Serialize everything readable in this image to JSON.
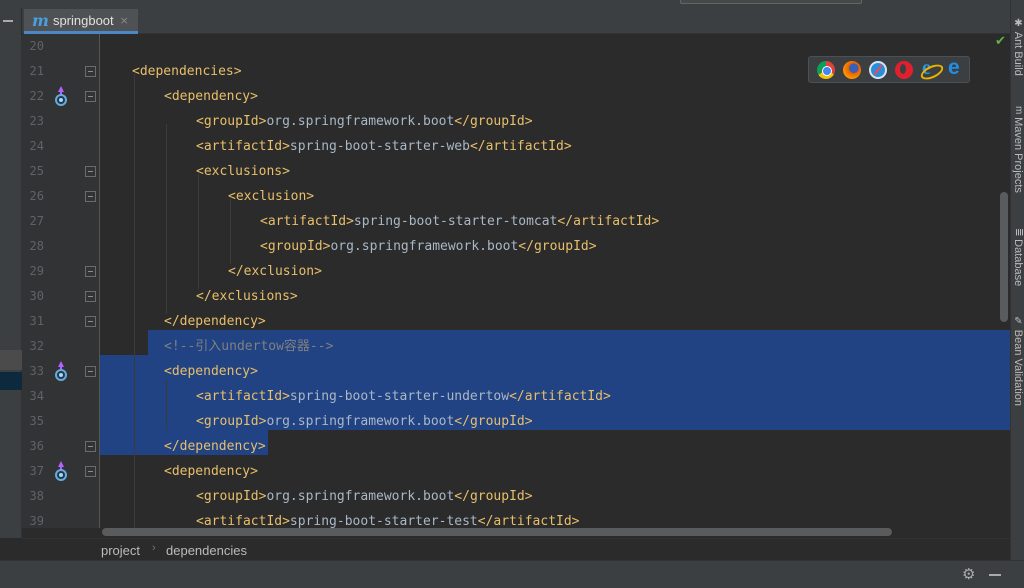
{
  "tab": {
    "icon": "maven-m-icon",
    "name": "springboot",
    "close": "×"
  },
  "lines": [
    {
      "no": "20",
      "html": []
    },
    {
      "no": "21",
      "html": [
        [
          "tg",
          "<dependencies>"
        ]
      ]
    },
    {
      "no": "22",
      "html": [
        [
          "tg",
          "<dependency>"
        ]
      ]
    },
    {
      "no": "23",
      "html": [
        [
          "tg",
          "<groupId>"
        ],
        [
          "tx",
          "org.springframework.boot"
        ],
        [
          "tg",
          "</groupId>"
        ]
      ]
    },
    {
      "no": "24",
      "html": [
        [
          "tg",
          "<artifactId>"
        ],
        [
          "tx",
          "spring-boot-starter-web"
        ],
        [
          "tg",
          "</artifactId>"
        ]
      ]
    },
    {
      "no": "25",
      "html": [
        [
          "tg",
          "<exclusions>"
        ]
      ]
    },
    {
      "no": "26",
      "html": [
        [
          "tg",
          "<exclusion>"
        ]
      ]
    },
    {
      "no": "27",
      "html": [
        [
          "tg",
          "<artifactId>"
        ],
        [
          "tx",
          "spring-boot-starter-tomcat"
        ],
        [
          "tg",
          "</artifactId>"
        ]
      ]
    },
    {
      "no": "28",
      "html": [
        [
          "tg",
          "<groupId>"
        ],
        [
          "tx",
          "org.springframework.boot"
        ],
        [
          "tg",
          "</groupId>"
        ]
      ]
    },
    {
      "no": "29",
      "html": [
        [
          "tg",
          "</exclusion>"
        ]
      ]
    },
    {
      "no": "30",
      "html": [
        [
          "tg",
          "</exclusions>"
        ]
      ]
    },
    {
      "no": "31",
      "html": [
        [
          "tg",
          "</dependency>"
        ]
      ]
    },
    {
      "no": "32",
      "html": [
        [
          "cm",
          "<!--引入undertow容器-->"
        ]
      ]
    },
    {
      "no": "33",
      "html": [
        [
          "tg",
          "<dependency>"
        ]
      ]
    },
    {
      "no": "34",
      "html": [
        [
          "tg",
          "<artifactId>"
        ],
        [
          "tx",
          "spring-boot-starter-undertow"
        ],
        [
          "tg",
          "</artifactId>"
        ]
      ]
    },
    {
      "no": "35",
      "html": [
        [
          "tg",
          "<groupId>"
        ],
        [
          "tx",
          "org.springframework.boot"
        ],
        [
          "tg",
          "</groupId>"
        ]
      ]
    },
    {
      "no": "36",
      "html": [
        [
          "tg",
          "</dependency>"
        ]
      ]
    },
    {
      "no": "37",
      "html": [
        [
          "tg",
          "<dependency>"
        ]
      ]
    },
    {
      "no": "38",
      "html": [
        [
          "tg",
          "<groupId>"
        ],
        [
          "tx",
          "org.springframework.boot"
        ],
        [
          "tg",
          "</groupId>"
        ]
      ]
    },
    {
      "no": "39",
      "html": [
        [
          "tg",
          "<artifactId>"
        ],
        [
          "tx",
          "spring-boot-starter-test"
        ],
        [
          "tg",
          "</artifactId>"
        ]
      ]
    }
  ],
  "browsers": [
    "chrome-icon",
    "firefox-icon",
    "safari-icon",
    "opera-icon",
    "internet-explorer-icon",
    "edge-icon"
  ],
  "right_tools": [
    {
      "icon": "ant-icon",
      "label": "Ant Build"
    },
    {
      "icon": "maven-icon",
      "label": "Maven Projects"
    },
    {
      "icon": "database-icon",
      "label": "Database"
    },
    {
      "icon": "bean-validation-icon",
      "label": "Bean Validation"
    }
  ],
  "breadcrumb": {
    "item1": "project",
    "sep": "›",
    "item2": "dependencies"
  },
  "status": {
    "gear_icon": "gear-icon",
    "minimize_icon": "minimize-icon"
  },
  "colors": {
    "tag": "#e8bf6a",
    "text": "#a9b7c6",
    "comment": "#808080",
    "selection": "#214283",
    "background": "#2b2b2b"
  }
}
